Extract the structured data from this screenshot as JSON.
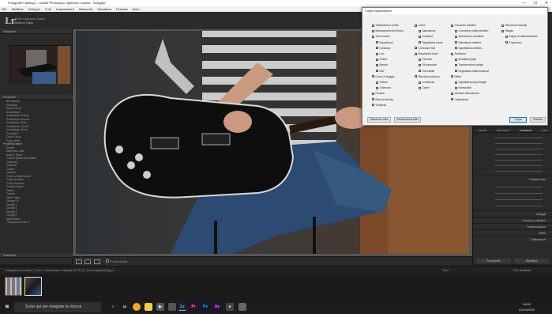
{
  "window": {
    "title": "Fotografie Catalog-2 - Adobe Photoshop Lightroom Classic - Sviluppo",
    "minimize": "—",
    "maximize": "☐",
    "close": "✕"
  },
  "menubar": [
    "File",
    "Modifica",
    "Sviluppo",
    "Foto",
    "Impostazioni",
    "Strumenti",
    "Visualizza",
    "Finestra",
    "Aiuto"
  ],
  "identity": {
    "logo": "Lr",
    "line1": "Adobe Lightroom Classic",
    "line2": "Stefano Gallo"
  },
  "modules": "Libreria | Sviluppo | Mappa | Libro | Presentazione | Stampa | Web",
  "left_panel": {
    "navigator": "Navigatore",
    "presets": "Predefiniti",
    "snapshots": "Istantanee",
    "preset_groups": [
      "BW Wavtop",
      "Sketchtop",
      "Sarah Franco",
      "Arcobalenpo",
      "Arcobalenpo Analog",
      "Arcobalenpo Narrow",
      "Arcobalenpo Tinte",
      "Arcobalenpo Opcerf",
      "Arcobalenpo Gene",
      "Crombaim",
      "Cross Luccio",
      "Enjoy Jadier"
    ],
    "user_presets": "Predefiniti utente",
    "user_items": [
      "Default",
      "Mattonella Calle",
      "Black & Filters",
      "Cinema (Blackmo) (estate)",
      "Cinema(1)",
      "Cinema2",
      "Classic",
      "Classic2",
      "Il Nuovo Calle Nesele",
      "Colori Nessario",
      "Colori Tramonto",
      "Dorina's Green",
      "Faded",
      "Foresta",
      "Matrix Taste",
      "Grunge Fin",
      "Grunge 1",
      "Grunge 2",
      "Grunge 3",
      "Grunge 4",
      "Night Nebet",
      "Traslazione Rusteo 1"
    ]
  },
  "dialog": {
    "title": "Copia impostazioni",
    "col1": [
      {
        "label": "Trattamento e profilo",
        "checked": true
      },
      {
        "label": "Bilanciamento del bianco",
        "checked": true
      },
      {
        "label": "Tono di base",
        "checked": true
      },
      {
        "label": "Esposizione",
        "checked": true
      },
      {
        "label": "Contrasto",
        "checked": true
      },
      {
        "label": "Luci",
        "checked": true
      },
      {
        "label": "Ombre",
        "checked": true
      },
      {
        "label": "Bianchi",
        "checked": true
      },
      {
        "label": "Neri",
        "checked": true
      },
      {
        "label": "Curva di viraggio",
        "checked": true
      },
      {
        "label": "Texture",
        "checked": true
      },
      {
        "label": "Chiarezza",
        "checked": true
      },
      {
        "label": "Foschia",
        "checked": false
      },
      {
        "label": "Rimuovi foschia",
        "checked": true
      },
      {
        "label": "Vividezza",
        "checked": false
      }
    ],
    "col2": [
      {
        "label": "Colore",
        "checked": true
      },
      {
        "label": "Saturazione",
        "checked": true
      },
      {
        "label": "Vividezza",
        "checked": true
      },
      {
        "label": "Regolazioni colore",
        "checked": true
      },
      {
        "label": "Correzione toni",
        "checked": true
      },
      {
        "label": "Regolazioni locali",
        "checked": false
      },
      {
        "label": "Pennello",
        "checked": false
      },
      {
        "label": "Filtri graduati",
        "checked": false
      },
      {
        "label": "Filtri radiali",
        "checked": false
      },
      {
        "label": "Rimozione disturbo",
        "checked": false
      },
      {
        "label": "Luminanza",
        "checked": false
      },
      {
        "label": "Colore",
        "checked": false
      }
    ],
    "col3": [
      {
        "label": "Correzioni obiettivo",
        "checked": false
      },
      {
        "label": "Correzione profilo obiettivo",
        "checked": false
      },
      {
        "label": "Aberrazione cromatica",
        "checked": false
      },
      {
        "label": "Distorsione obiettivo",
        "checked": false
      },
      {
        "label": "Vignettatura obiettivo",
        "checked": false
      },
      {
        "label": "Trasforma",
        "checked": false
      },
      {
        "label": "Modalità upright",
        "checked": false
      },
      {
        "label": "Trasformazioni upright",
        "checked": false
      },
      {
        "label": "Regolazioni trasformazione",
        "checked": false
      },
      {
        "label": "Effetti",
        "checked": false
      },
      {
        "label": "Vignettatura dopo ritaglio",
        "checked": false
      },
      {
        "label": "Granulosità",
        "checked": false
      },
      {
        "label": "Versione elaborazione",
        "checked": true
      },
      {
        "label": "Calibrazione",
        "checked": true
      }
    ],
    "col4": [
      {
        "label": "Rimozione macchie",
        "checked": false
      },
      {
        "label": "Ritaglio",
        "checked": false
      },
      {
        "label": "Angolo di raddrizzamento",
        "checked": false
      },
      {
        "label": "Proporzioni",
        "checked": false
      }
    ],
    "check_all": "Seleziona tutto",
    "check_none": "Deseleziona tutto",
    "copy": "Copia",
    "cancel": "Annulla"
  },
  "right_panel": {
    "tabs": [
      "Tonalità",
      "Saturazione",
      "Luminanza",
      "Tutto"
    ],
    "sections": [
      "Divisione toni",
      "Dettagli",
      "Correzioni obiettivo",
      "Trasformazione",
      "Effetti",
      "Calibrazione"
    ],
    "prev_button": "Precedente",
    "reset_button": "Ripristina"
  },
  "toolbar": {
    "soft_proof": "Prova colori"
  },
  "filmbar": {
    "info": "Fotografie precedente  |  1 foto / 1 selezionata / Nightrain-IP-20_03_19-immagine012.jpg ▾",
    "filter": "Filtro :",
    "filter_value": "Filtri disattivati"
  },
  "taskbar": {
    "search": "Scrivi qui per eseguire la ricerca",
    "time": "16:53",
    "date": "02/04/2020"
  }
}
